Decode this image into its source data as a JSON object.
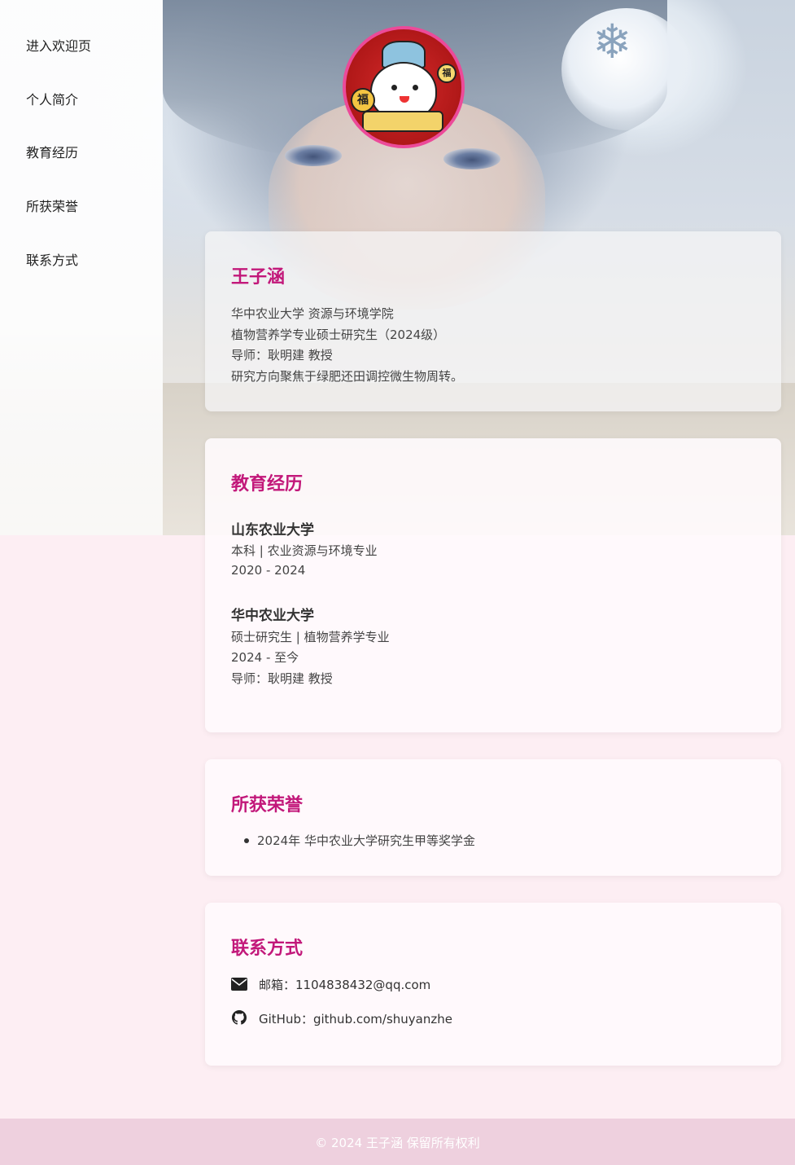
{
  "sidebar": {
    "items": [
      {
        "label": "进入欢迎页"
      },
      {
        "label": "个人简介"
      },
      {
        "label": "教育经历"
      },
      {
        "label": "所获荣誉"
      },
      {
        "label": "联系方式"
      }
    ]
  },
  "avatar": {
    "glyph_main": "福",
    "glyph_small": "福"
  },
  "profile": {
    "name": "王子涵",
    "lines": [
      "华中农业大学 资源与环境学院",
      "植物营养学专业硕士研究生（2024级）",
      "导师：耿明建 教授",
      "研究方向聚焦于绿肥还田调控微生物周转。"
    ]
  },
  "education": {
    "title": "教育经历",
    "entries": [
      {
        "school": "山东农业大学",
        "degree": "本科 | 农业资源与环境专业",
        "period": "2020 - 2024"
      },
      {
        "school": "华中农业大学",
        "degree": "硕士研究生 | 植物营养学专业",
        "period": "2024 - 至今",
        "advisor": "导师：耿明建 教授"
      }
    ]
  },
  "honors": {
    "title": "所获荣誉",
    "items": [
      "2024年 华中农业大学研究生甲等奖学金"
    ]
  },
  "contact": {
    "title": "联系方式",
    "email": "邮箱：1104838432@qq.com",
    "github": "GitHub：github.com/shuyanzhe",
    "icons": [
      "envelope-icon",
      "github-icon"
    ]
  },
  "footer": {
    "text": "© 2024 王子涵 保留所有权利"
  },
  "colors": {
    "accent": "#c2187a",
    "avatar_border": "#ec4a99",
    "background": "#fdeef3",
    "footer_bg": "#eed0de"
  }
}
